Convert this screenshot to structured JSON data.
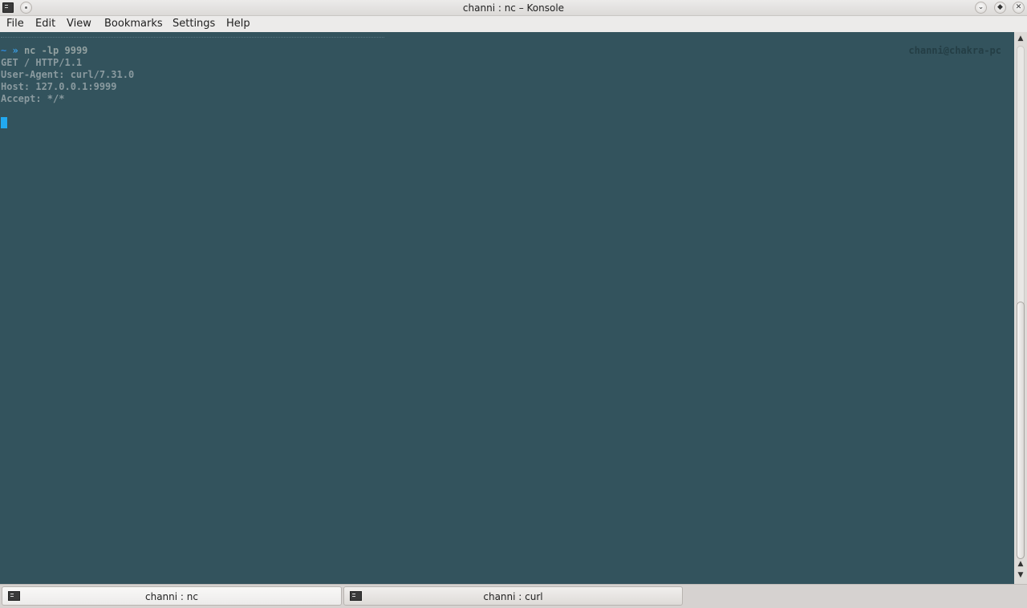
{
  "window": {
    "title": "channi : nc – Konsole"
  },
  "titlebar_buttons": {
    "min_glyph": "⌄",
    "max_glyph": "◆",
    "close_glyph": "✕"
  },
  "menubar": {
    "items": [
      "File",
      "Edit",
      "View",
      "Bookmarks",
      "Settings",
      "Help"
    ]
  },
  "terminal": {
    "prompt_tilde": "~",
    "prompt_arrow": "»",
    "command": "nc -lp 9999",
    "hostname": "channi@chakra-pc",
    "output_lines": [
      "GET / HTTP/1.1",
      "User-Agent: curl/7.31.0",
      "Host: 127.0.0.1:9999",
      "Accept: */*"
    ],
    "colors": {
      "background": "#33535d",
      "text": "#8a9a9f",
      "cursor": "#22a9f0"
    }
  },
  "scrollbar": {
    "up_glyph": "▲",
    "down_glyph": "▼",
    "position": 1.0
  },
  "tabs": [
    {
      "label": "channi : nc",
      "icon": "terminal-icon",
      "active": true
    },
    {
      "label": "channi : curl",
      "icon": "terminal-icon",
      "active": false
    }
  ]
}
